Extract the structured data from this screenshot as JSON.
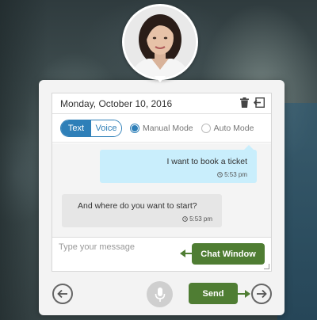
{
  "header": {
    "date": "Monday, October 10, 2016"
  },
  "mode": {
    "toggle_text": "Text",
    "toggle_voice": "Voice",
    "active_toggle": "Text",
    "manual_label": "Manual Mode",
    "auto_label": "Auto Mode",
    "selected_mode": "Manual Mode"
  },
  "messages": [
    {
      "direction": "outgoing",
      "text": "I want to book a ticket",
      "time": "5:53 pm"
    },
    {
      "direction": "incoming",
      "text": "And where do you want to start?",
      "time": "5:53 pm"
    }
  ],
  "composer": {
    "placeholder": "Type your message",
    "value": ""
  },
  "annotations": {
    "chat_window": "Chat Window",
    "send": "Send"
  },
  "icons": {
    "trash": "trash-icon",
    "exit": "exit-icon",
    "clock": "clock-icon",
    "back": "arrow-left-circle-icon",
    "mic": "microphone-icon",
    "send": "arrow-right-circle-icon"
  },
  "colors": {
    "accent_blue": "#2e7fb8",
    "outgoing_bubble": "#c9eefc",
    "incoming_bubble": "#e6e6e6",
    "callout_green": "#4f7d33"
  }
}
